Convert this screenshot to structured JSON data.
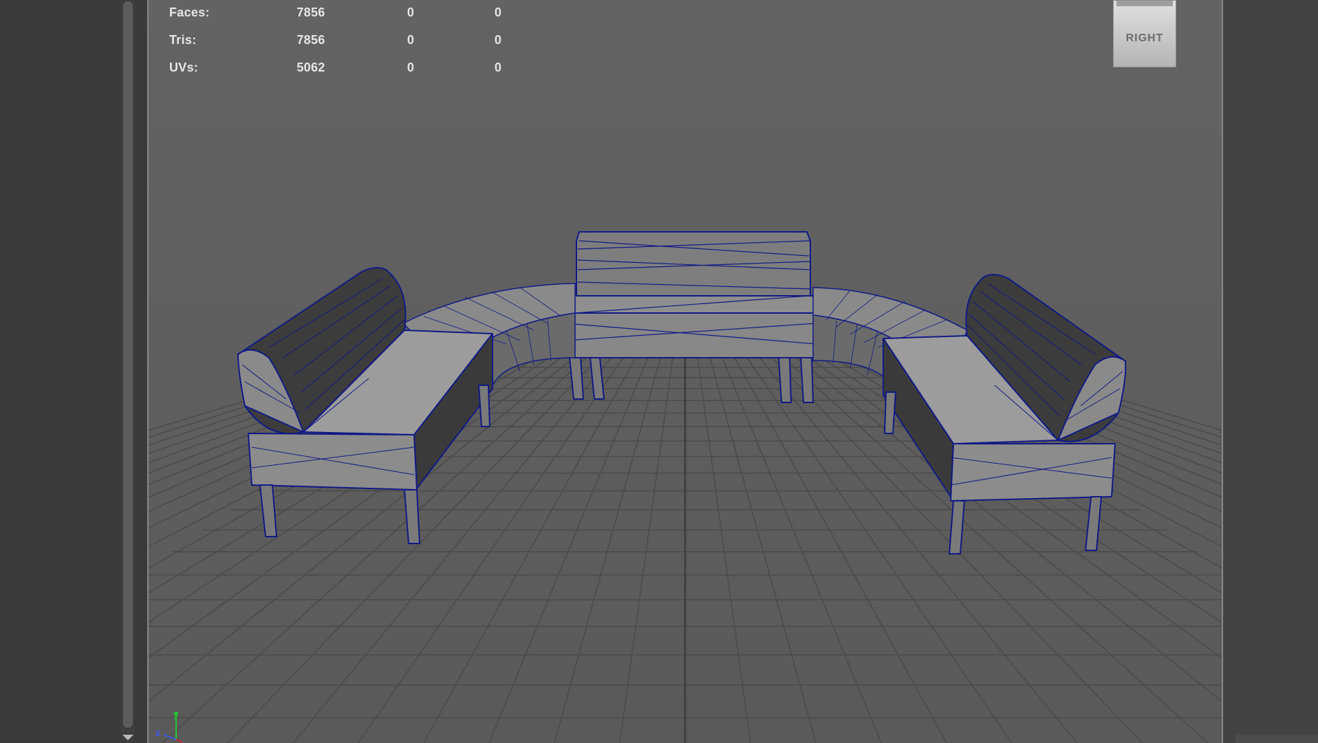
{
  "hud": {
    "rows": [
      {
        "label": "Faces:",
        "v1": "7856",
        "v2": "0",
        "v3": "0"
      },
      {
        "label": "Tris:",
        "v1": "7856",
        "v2": "0",
        "v3": "0"
      },
      {
        "label": "UVs:",
        "v1": "5062",
        "v2": "0",
        "v3": "0"
      }
    ]
  },
  "viewcube": {
    "face_label": "RIGHT"
  },
  "axis_indicator": {
    "x": "x",
    "y": "y",
    "z": "z"
  },
  "colors": {
    "wireframe": "#0f1a86",
    "viewport_background": "#5f5f5f",
    "grid": "#4a4a4a",
    "axis_x": "#d22020",
    "axis_y": "#22c830",
    "axis_z": "#3a5cf0"
  },
  "icons": [
    "viewcube-icon",
    "axis-indicator-icon",
    "scroll-down-arrow-icon"
  ]
}
